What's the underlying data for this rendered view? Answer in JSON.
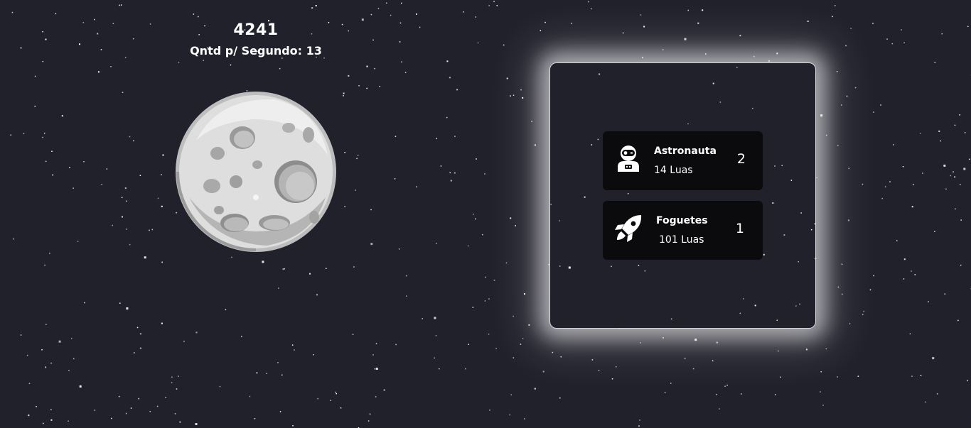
{
  "game": {
    "score": "4241",
    "per_second": "Qntd p/ Segundo: 13"
  },
  "colors": {
    "background": "#21212c",
    "card": "#0b0b0e",
    "text": "#ffffff",
    "panel_border": "#d8d8e0",
    "glow": "#ffffff"
  },
  "moon": {
    "icon": "moon-icon"
  },
  "shop": {
    "items": [
      {
        "name": "Astronauta",
        "cost": "14 Luas",
        "owned": "2",
        "icon": "astronaut-icon"
      },
      {
        "name": "Foguetes",
        "cost": "101 Luas",
        "owned": "1",
        "icon": "rocket-icon"
      }
    ]
  }
}
